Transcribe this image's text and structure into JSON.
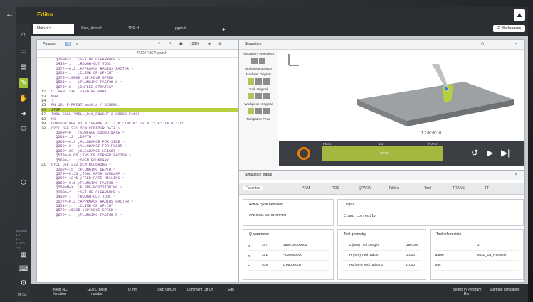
{
  "titlebar": {
    "title": "Editor",
    "back_icon": "arrow-left-icon"
  },
  "tabs": [
    {
      "label": "Main.h"
    },
    {
      "label": "Start_demo.h"
    },
    {
      "label": "TNC:H"
    },
    {
      "label": "pgph.h"
    }
  ],
  "workspaces": "Workspaces",
  "program": {
    "label": "Program",
    "path": "TNC:\\TNC7\\Main.h",
    "zoom": "100%"
  },
  "code": [
    {
      "n": "",
      "t": "  Q200=+2   ;SET-UP CLEARANCE ~"
    },
    {
      "n": "",
      "t": "  Q438=-1   ;ROUGH-OUT TOOL ~"
    },
    {
      "n": "",
      "t": "  Q577=+0.2 ;APPROACH RADIUS FACTOR ~"
    },
    {
      "n": "",
      "t": "  Q351=-1   ;CLIMB OR UP-CUT ~"
    },
    {
      "n": "",
      "t": "  Q578=+18000 ;SPINDLE SPEED ~"
    },
    {
      "n": "",
      "t": "  Q581=+1   ;PLUNGING FACTOR S ~"
    },
    {
      "n": "",
      "t": "  Q575=+2   ;INFEED STRATEGY"
    },
    {
      "n": "12",
      "t": "L  X+0  Y+0  Z+80 R0 FMAX"
    },
    {
      "n": "13",
      "t": "M99"
    },
    {
      "n": "14",
      "t": ";"
    },
    {
      "n": "15",
      "t": "FN 16: F-PRINT mask.a / SCREEN:"
    },
    {
      "n": "16",
      "t": "STOP"
    },
    {
      "n": "17",
      "t": "TOOL CALL \"MILL_D16_ROUGH\" Z S8000 F1000"
    },
    {
      "n": "18",
      "t": "M3"
    },
    {
      "n": "19",
      "t": "CONTOUR DEF P1 = \"FRAME.H\" I2 = \"TNC.H\" I3 = \"7.H\" I4 = \"ISL"
    },
    {
      "n": "20",
      "t": "CYCL DEF 271 OCM CONTOUR DATA ~"
    },
    {
      "n": "",
      "t": "  Q203=+0   ;SURFACE COORDINATE ~"
    },
    {
      "n": "",
      "t": "  Q201=-12  ;DEPTH ~"
    },
    {
      "n": "",
      "t": "  Q368=+0.3 ;ALLOWANCE FOR SIDE ~"
    },
    {
      "n": "",
      "t": "  Q369=+0   ;ALLOWANCE FOR FLOOR ~"
    },
    {
      "n": "",
      "t": "  Q260=+20  ;CLEARANCE HEIGHT ~"
    },
    {
      "n": "",
      "t": "  Q578=+0.05 ;INSIDE CORNER FACTOR ~"
    },
    {
      "n": "",
      "t": "  Q569=+1   ;OPEN BOUNDARY"
    },
    {
      "n": "21",
      "t": "CYCL DEF 272 OCM ROUGHING ~"
    },
    {
      "n": "",
      "t": "  Q202=+15  ;PLUNGING DEPTH ~"
    },
    {
      "n": "",
      "t": "  Q370=+0.53 ;TOOL PATH OVERLAP ~"
    },
    {
      "n": "",
      "t": "  Q207=+1245 ;FEED RATE MILLING ~"
    },
    {
      "n": "",
      "t": "  Q568=+0.6 ;PLUNGING FACTOR ~"
    },
    {
      "n": "",
      "t": "  Q253=MAX  ;F PRE-POSITIONING ~"
    },
    {
      "n": "",
      "t": "  Q200=+2   ;SET-UP CLEARANCE ~"
    },
    {
      "n": "",
      "t": "  Q438=-1   ;ROUGH-OUT TOOL ~"
    },
    {
      "n": "",
      "t": "  Q577=+0.2 ;APPROACH RADIUS FACTOR ~"
    },
    {
      "n": "",
      "t": "  Q351=-1   ;CLIMB OR UP-CUT ~"
    },
    {
      "n": "",
      "t": "  Q576=+15395 ;SPINDLE SPEED ~"
    },
    {
      "n": "",
      "t": "  Q579=+1   ;PLUNGING FACTOR S ~"
    }
  ],
  "simulation": {
    "label": "Simulation",
    "side": [
      "Simulation: Workpiece",
      "Workpiece position",
      "Machine: Original",
      "Tool: Original",
      "Workpiece: Original",
      "Tool paths: Feed"
    ],
    "t2": "T 2  00:00:10",
    "feed": {
      "fmin": "FMIN",
      "ratio": "1:1",
      "fmax": "FMAX",
      "f": "F MAX"
    }
  },
  "status": {
    "label": "Simulation status",
    "tabs": [
      "Favorites",
      "PGM",
      "POS",
      "QPARA",
      "Tables",
      "Tool",
      "TRANS",
      "TT"
    ],
    "active_cycle": {
      "title": "Active cycle definition",
      "value": "272 OCM SCHRUPPEN"
    },
    "output": {
      "title": "Output",
      "value": "Clamp correctly"
    },
    "qparams": {
      "title": "Q parameter",
      "rows": [
        [
          "Q",
          "207",
          "1959.00000000"
        ],
        [
          "Q",
          "201",
          "-0.20000000"
        ],
        [
          "Q",
          "578",
          "0.05000000"
        ]
      ]
    },
    "toolgeom": {
      "title": "Tool geometry",
      "rows": [
        [
          "L (mm)  Tool Length",
          "160.000"
        ],
        [
          "R (mm)  Tool radius",
          "3.000"
        ],
        [
          "R2 (mm) Tool radius 2",
          "0.000"
        ]
      ]
    },
    "toolinfo": {
      "title": "Tool information",
      "rows": [
        [
          "T",
          "2"
        ],
        [
          "Name",
          "MILL_D4_ROUGH"
        ],
        [
          "Doc",
          ""
        ]
      ]
    }
  },
  "softkeys": [
    "Insert NC function",
    "GOTO block number",
    "Q info",
    "Skip Off/On",
    "Comment Off On",
    "Edit",
    "Select in Program Run",
    "Start the simulation"
  ],
  "leftinfo": [
    "00:00:00",
    "1 3",
    "8 4",
    "S 1500",
    "F 0"
  ],
  "time": "06:52"
}
